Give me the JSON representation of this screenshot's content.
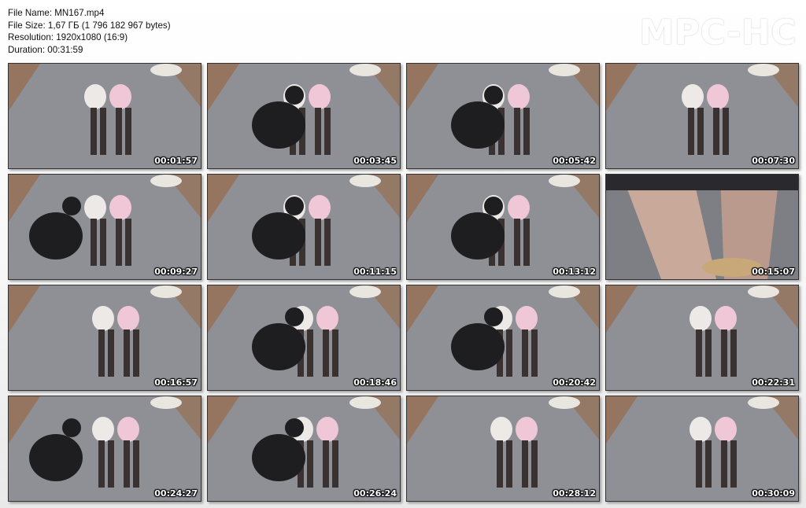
{
  "info": {
    "file_name": "File Name: MN167.mp4",
    "file_size": "File Size: 1,67 ГБ (1 796 182 967 bytes)",
    "resolution": "Resolution: 1920x1080 (16:9)",
    "duration": "Duration: 00:31:59"
  },
  "logo": "MPC-HC",
  "thumbnails": [
    {
      "time": "00:01:57"
    },
    {
      "time": "00:03:45"
    },
    {
      "time": "00:05:42"
    },
    {
      "time": "00:07:30"
    },
    {
      "time": "00:09:27"
    },
    {
      "time": "00:11:15"
    },
    {
      "time": "00:13:12"
    },
    {
      "time": "00:15:07"
    },
    {
      "time": "00:16:57"
    },
    {
      "time": "00:18:46"
    },
    {
      "time": "00:20:42"
    },
    {
      "time": "00:22:31"
    },
    {
      "time": "00:24:27"
    },
    {
      "time": "00:26:24"
    },
    {
      "time": "00:28:12"
    },
    {
      "time": "00:30:09"
    }
  ]
}
